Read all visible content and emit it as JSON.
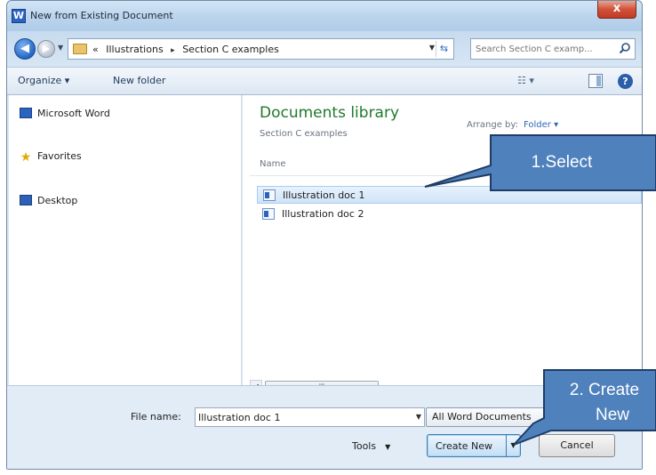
{
  "window": {
    "title": "New from Existing Document",
    "close_label": "x",
    "app_icon_letter": "W"
  },
  "address": {
    "overflow": "«",
    "crumbs": [
      "Illustrations",
      "Section C examples"
    ],
    "separator": "▸"
  },
  "search": {
    "placeholder": "Search Section C examp..."
  },
  "toolbar": {
    "organize_label": "Organize ▾",
    "new_folder_label": "New folder",
    "views_label": "☷ ▾",
    "help_label": "?"
  },
  "nav": {
    "items": [
      {
        "label": "Microsoft Word",
        "icon": "word-icon"
      },
      {
        "label": "Favorites",
        "icon": "star-icon"
      },
      {
        "label": "Desktop",
        "icon": "desktop-icon"
      }
    ]
  },
  "library": {
    "title": "Documents library",
    "subtitle": "Section C examples",
    "arrange_label": "Arrange by:",
    "arrange_value": "Folder ▾",
    "column_name": "Name",
    "files": [
      {
        "name": "Illustration doc 1",
        "selected": true
      },
      {
        "name": "Illustration doc 2",
        "selected": false
      }
    ],
    "scroll_thumb": "III"
  },
  "footer": {
    "filename_label": "File name:",
    "filename_value": "Illustration doc 1",
    "filetype_value": "All Word Documents",
    "tools_label": "Tools",
    "create_new_label": "Create New",
    "cancel_label": "Cancel"
  },
  "callouts": {
    "select": "1.Select",
    "create_line1": "2. Create",
    "create_line2": "New",
    "fill_color": "#4f81bd",
    "border_color": "#1f3c66"
  },
  "colors": {
    "library_title": "#1f7a2c",
    "accent": "#2b64c0",
    "close_button": "#c03a22"
  }
}
